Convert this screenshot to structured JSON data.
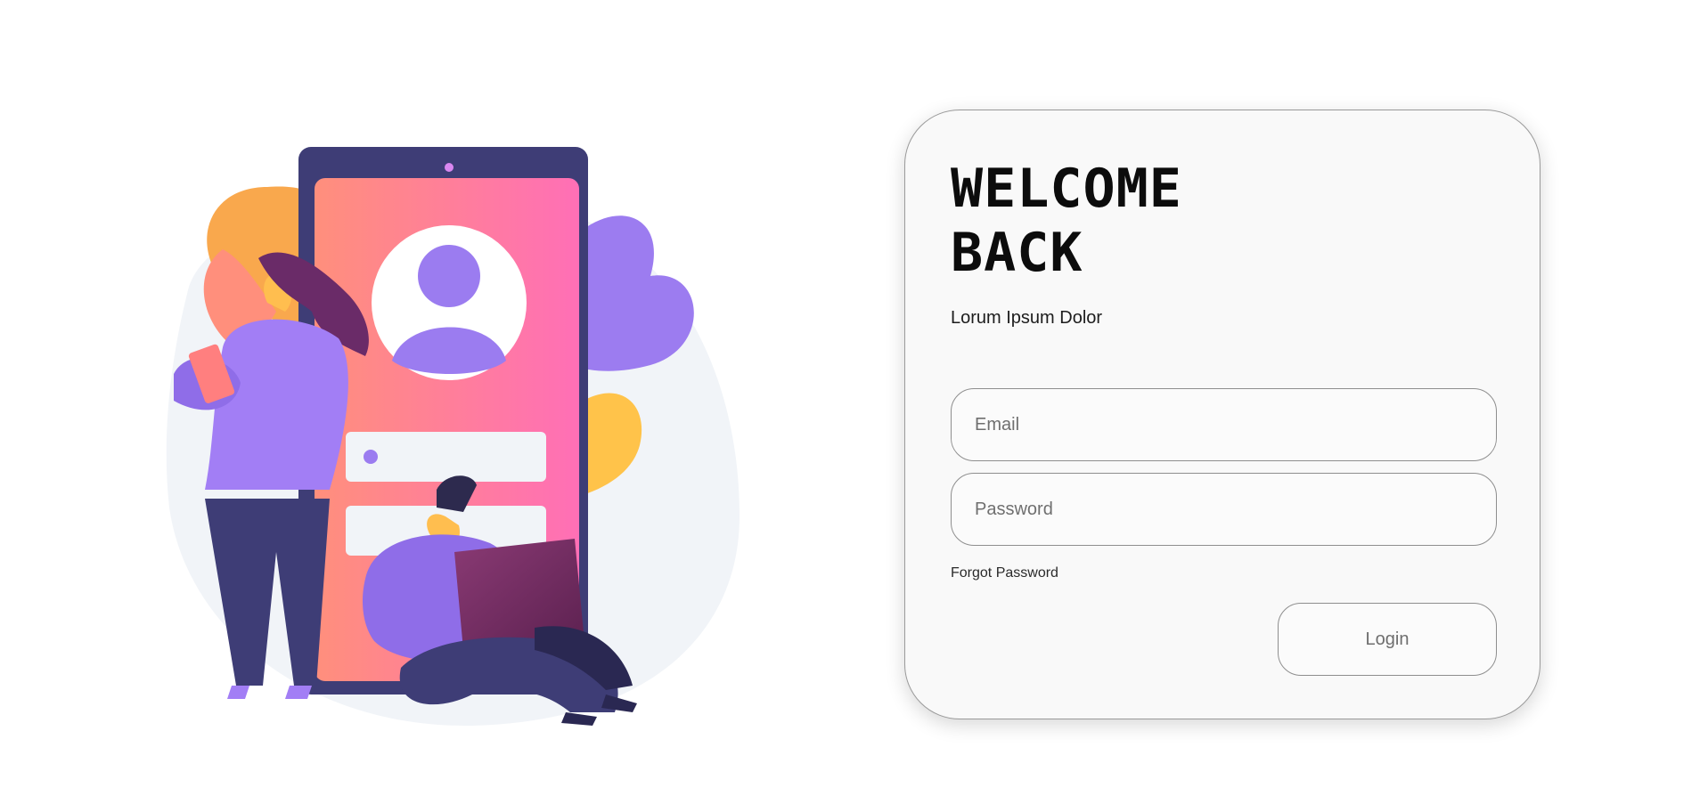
{
  "illustration": {
    "icon": "person-login-illustration",
    "colors": {
      "phone_frame": "#3e3d76",
      "screen_start": "#ff8f7c",
      "screen_end": "#ff6fb6",
      "avatar": "#9b7cf0",
      "leaf_orange": "#f9a84d",
      "leaf_purple": "#9c7cf0",
      "leaf_yellow": "#ffc34a",
      "backdrop": "#f1f4f8"
    }
  },
  "login_card": {
    "title_line1": "WELCOME",
    "title_line2": "BACK",
    "subtitle": "Lorum Ipsum Dolor",
    "email_placeholder": "Email",
    "password_placeholder": "Password",
    "forgot_password": "Forgot Password",
    "login_label": "Login"
  }
}
